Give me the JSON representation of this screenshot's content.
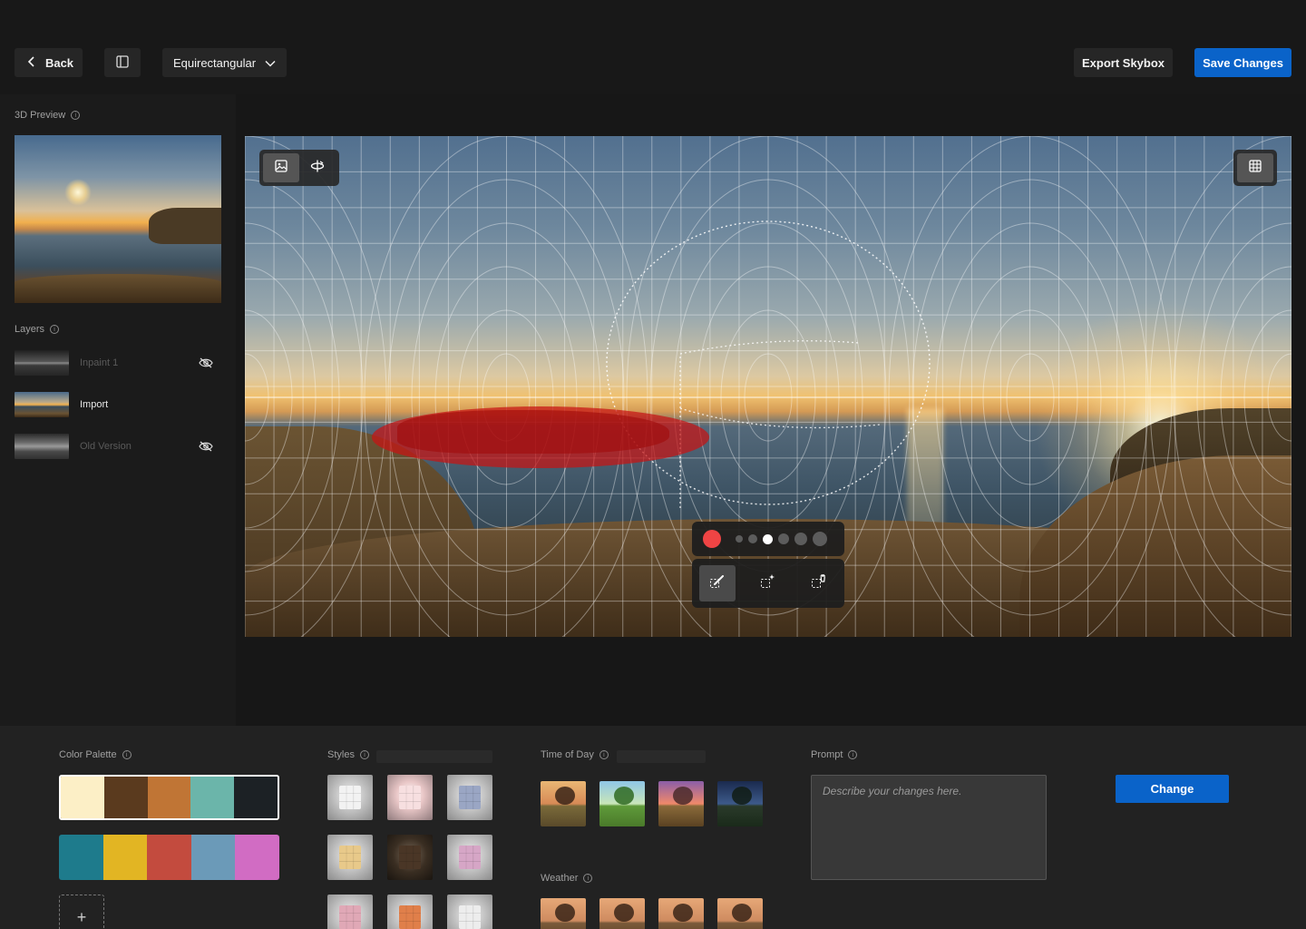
{
  "header": {
    "back_label": "Back",
    "projection_label": "Equirectangular",
    "export_label": "Export Skybox",
    "save_label": "Save Changes"
  },
  "sidebar": {
    "preview_label": "3D Preview",
    "layers_label": "Layers",
    "layers": [
      {
        "name": "Inpaint 1",
        "hidden": true
      },
      {
        "name": "Import",
        "hidden": false
      },
      {
        "name": "Old Version",
        "hidden": true
      }
    ]
  },
  "editor": {
    "brush_color": "#ef4444",
    "brush_sizes": 6,
    "selected_brush_size": 3,
    "mask_color": "#d41a1a"
  },
  "bottom": {
    "color_palette_label": "Color Palette",
    "palettes": [
      [
        "#fcefc6",
        "#5a3a1e",
        "#c07535",
        "#6bb5aa",
        "#1c2125"
      ],
      [
        "#1e7b8c",
        "#e2b523",
        "#c34b3e",
        "#6b9ab8",
        "#d16cc3"
      ]
    ],
    "add_label": "+",
    "styles_label": "Styles",
    "time_of_day_label": "Time of Day",
    "weather_label": "Weather",
    "prompt_label": "Prompt",
    "prompt_placeholder": "Describe your changes here.",
    "change_label": "Change"
  }
}
